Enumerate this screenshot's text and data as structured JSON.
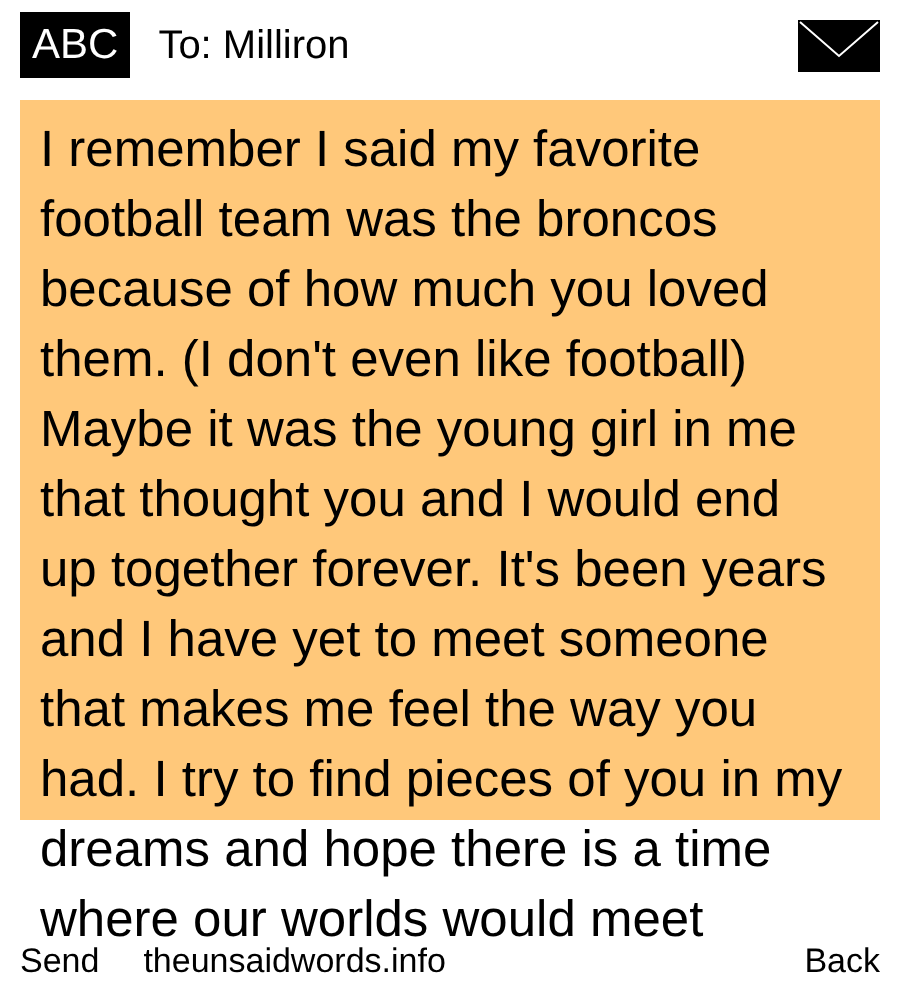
{
  "header": {
    "logo": "ABC",
    "recipient": "To: Milliron"
  },
  "message": {
    "text": "I remember I said my favorite football team was the broncos because of how much you loved them. (I don't even like football) Maybe it was the young girl in me that thought you and I would end up together forever. It's been years and I have yet to meet someone that makes me feel the way you had. I try to find pieces of you in my dreams and hope there is a time where our worlds would meet"
  },
  "bottom_bar": {
    "left": "Send",
    "site": "theunsaidwords.info",
    "right": "Back"
  }
}
